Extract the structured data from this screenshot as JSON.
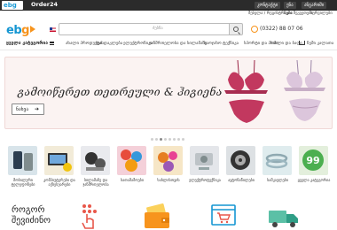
{
  "topbar": {
    "logo": "ebg",
    "brand": "Order24",
    "links": [
      "კონტაქტი",
      "ენა",
      "ანგარიში"
    ]
  },
  "account": {
    "items": [
      "შესვლა / რეგისტრაცია",
      "ჩემი შეკვეთები",
      "სურვილები"
    ]
  },
  "header": {
    "logo_part1": "eb",
    "logo_part2": "g",
    "search": {
      "placeholder": "ძებნა"
    },
    "phone": "(0322) 88 07 06"
  },
  "nav": {
    "all_categories": "ყველა კატეგორია",
    "items": [
      "ახალი პროდუქტი",
      "ფასდაკლება",
      "ელექტრონიკა",
      "ჯანმრთელობა და სილამაზე",
      "საოჯახო ტექნიკა",
      "სპორტი და ჰობი",
      "სახლი და ბაღი"
    ],
    "cart": "ჩემი კალათა"
  },
  "banner": {
    "title": "გამოიწერეთ თეთრეული & ჰიგიენა",
    "button": "ნახვა",
    "button_arrow": "➔",
    "dots": 8,
    "active_dot": 2
  },
  "categories": [
    {
      "label": "მობილური ტელეფონები",
      "icon": "phone-category-icon",
      "bg": "#d8e4ea"
    },
    {
      "label": "კომპიუტერები და აქსესუარები",
      "icon": "computer-category-icon",
      "bg": "#f2ebd8"
    },
    {
      "label": "სილამაზე და ჯანმრთელობა",
      "icon": "beauty-category-icon",
      "bg": "#e9eaee"
    },
    {
      "label": "სათამაშოები",
      "icon": "toys-category-icon",
      "bg": "#f4d0d9"
    },
    {
      "label": "სახლისთვის",
      "icon": "home-category-icon",
      "bg": "#f6e6c6"
    },
    {
      "label": "ელექტროტექნიკა",
      "icon": "appliance-category-icon",
      "bg": "#e4e6ea"
    },
    {
      "label": "ავტონაწილები",
      "icon": "auto-category-icon",
      "bg": "#dde1e4"
    },
    {
      "label": "სამკაულები",
      "icon": "jewelry-category-icon",
      "bg": "#dfecee"
    },
    {
      "label": "ყველა კატეგორია",
      "icon": "all-categories-icon",
      "bg": "#e3efdc"
    }
  ],
  "all_badge": "99",
  "how": {
    "title_line1": "როგორ",
    "title_line2": "შევიძინო"
  },
  "colors": {
    "accent": "#f7941d",
    "brand_blue": "#1596d2",
    "topbar": "#2b2b2b",
    "banner_bg": "#fbf3f2",
    "lingerie": "#c2385f"
  }
}
